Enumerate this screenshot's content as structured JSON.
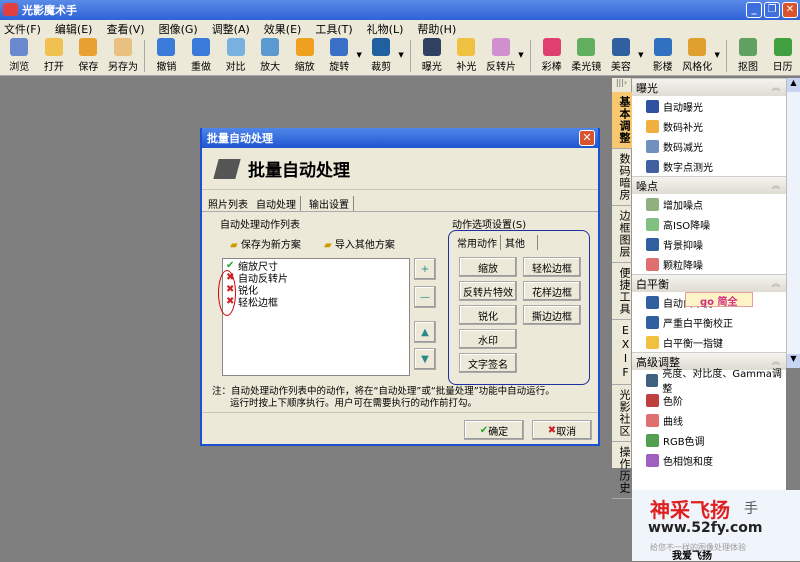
{
  "app": {
    "title": "光影魔术手",
    "buttons": [
      "_",
      "❐",
      "✕"
    ]
  },
  "menu": [
    "文件(F)",
    "编辑(E)",
    "查看(V)",
    "图像(G)",
    "调整(A)",
    "效果(E)",
    "工具(T)",
    "礼物(L)",
    "帮助(H)"
  ],
  "toolbar": [
    {
      "label": "浏览",
      "color": "#6a8ad0"
    },
    {
      "label": "打开",
      "color": "#f0c050"
    },
    {
      "label": "保存",
      "color": "#e8a030"
    },
    {
      "label": "另存为",
      "color": "#e8c080"
    },
    "|",
    {
      "label": "撤销",
      "color": "#3a7ad8"
    },
    {
      "label": "重做",
      "color": "#3a7ad8"
    },
    {
      "label": "对比",
      "color": "#78b0e0"
    },
    {
      "label": "放大",
      "color": "#5a9ad0"
    },
    {
      "label": "缩放",
      "color": "#f0a020"
    },
    {
      "label": "旋转",
      "color": "#3a70c8",
      "dd": true
    },
    {
      "label": "裁剪",
      "color": "#2060a0",
      "dd": true
    },
    "|",
    {
      "label": "曝光",
      "color": "#304060"
    },
    {
      "label": "补光",
      "color": "#f0c040"
    },
    {
      "label": "反转片",
      "color": "#d090d0",
      "dd": true
    },
    "|",
    {
      "label": "彩棒",
      "color": "#e04070"
    },
    {
      "label": "柔光镜",
      "color": "#60b060"
    },
    {
      "label": "美容",
      "color": "#3060a0",
      "dd": true
    },
    {
      "label": "影楼",
      "color": "#3070c0"
    },
    {
      "label": "风格化",
      "color": "#e0a030",
      "dd": true
    },
    "|",
    {
      "label": "抠图",
      "color": "#60a060"
    },
    {
      "label": "日历",
      "color": "#40a040"
    }
  ],
  "vtabs": [
    "基本调整",
    "数码暗房",
    "边框图层",
    "便捷工具",
    "EXIF",
    "光影社区",
    "操作历史"
  ],
  "panel": [
    {
      "title": "曝光",
      "items": [
        {
          "label": "自动曝光",
          "color": "#3050a0"
        },
        {
          "label": "数码补光",
          "color": "#f0b040"
        },
        {
          "label": "数码减光",
          "color": "#7090c0"
        },
        {
          "label": "数字点测光",
          "color": "#4060a0"
        }
      ]
    },
    {
      "title": "噪点",
      "items": [
        {
          "label": "增加噪点",
          "color": "#90b080"
        },
        {
          "label": "高ISO降噪",
          "color": "#80c080"
        },
        {
          "label": "背景抑噪",
          "color": "#3060a0"
        },
        {
          "label": "颗粒降噪",
          "color": "#e07070"
        }
      ]
    },
    {
      "title": "白平衡",
      "items": [
        {
          "label": "自动白平衡",
          "color": "#3060a0"
        },
        {
          "label": "严重白平衡校正",
          "color": "#3060a0"
        },
        {
          "label": "白平衡一指键",
          "color": "#f0c040"
        }
      ]
    },
    {
      "title": "高级调整",
      "items": [
        {
          "label": "亮度、对比度、Gamma调整",
          "color": "#406080"
        },
        {
          "label": "色阶",
          "color": "#c04040"
        },
        {
          "label": "曲线",
          "color": "#e07070"
        },
        {
          "label": "RGB色调",
          "color": "#50a050"
        },
        {
          "label": "色相饱和度",
          "color": "#a060c0"
        }
      ]
    }
  ],
  "overlay_tag": "go 简全",
  "promo": {
    "brand": "神采飞扬",
    "url": "www.52fy.com",
    "hand": "手",
    "tagline": "给您不一样的图像处理体验",
    "sig": "我爱飞扬"
  },
  "dialog": {
    "title": "批量自动处理",
    "heading": "批量自动处理",
    "tabs": [
      "照片列表",
      "自动处理",
      "输出设置"
    ],
    "list_label": "自动处理动作列表",
    "save_scheme": "保存为新方案",
    "import_scheme": "导入其他方案",
    "actions": [
      {
        "label": "缩放尺寸",
        "checked": true
      },
      {
        "label": "自动反转片",
        "checked": false
      },
      {
        "label": "锐化",
        "checked": false
      },
      {
        "label": "轻松边框",
        "checked": false
      }
    ],
    "side_buttons": [
      "+",
      "—",
      "▲",
      "▼"
    ],
    "options_label": "动作选项设置(S)",
    "option_tabs": [
      "常用动作",
      "其他"
    ],
    "option_buttons": [
      "缩放",
      "轻松边框",
      "反转片特效",
      "花样边框",
      "锐化",
      "撕边边框",
      "水印",
      "文字签名"
    ],
    "note_line1": "注：自动处理动作列表中的动作，将在“自动处理”或“批量处理”功能中自动运行。",
    "note_line2": "运行时按上下顺序执行。用户可在需要执行的动作前打勾。",
    "ok": "确定",
    "cancel": "取消"
  }
}
